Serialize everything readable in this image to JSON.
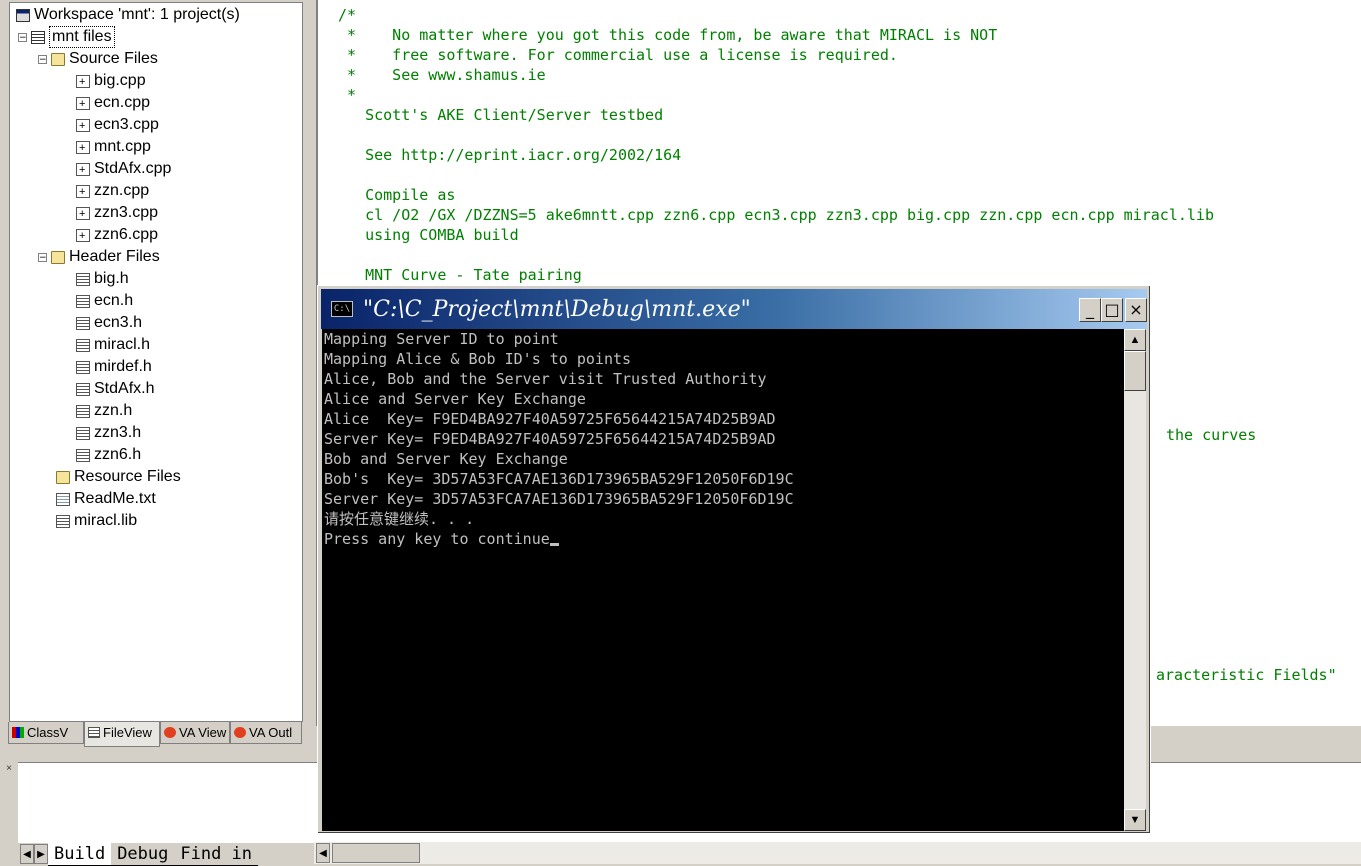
{
  "workspace": {
    "title": "Workspace 'mnt': 1 project(s)",
    "project": "mnt files",
    "source_folder": "Source Files",
    "source_files": [
      "big.cpp",
      "ecn.cpp",
      "ecn3.cpp",
      "mnt.cpp",
      "StdAfx.cpp",
      "zzn.cpp",
      "zzn3.cpp",
      "zzn6.cpp"
    ],
    "header_folder": "Header Files",
    "header_files": [
      "big.h",
      "ecn.h",
      "ecn3.h",
      "miracl.h",
      "mirdef.h",
      "StdAfx.h",
      "zzn.h",
      "zzn3.h",
      "zzn6.h"
    ],
    "resource_folder": "Resource Files",
    "other_files": [
      "ReadMe.txt",
      "miracl.lib"
    ],
    "tabs": [
      "ClassV",
      "FileView",
      "VA View",
      "VA Outl"
    ]
  },
  "editor": {
    "lines": [
      "/*",
      " *    No matter where you got this code from, be aware that MIRACL is NOT",
      " *    free software. For commercial use a license is required.",
      " *    See www.shamus.ie",
      " *",
      "   Scott's AKE Client/Server testbed",
      "",
      "   See http://eprint.iacr.org/2002/164",
      "",
      "   Compile as",
      "   cl /O2 /GX /DZZNS=5 ake6mntt.cpp zzn6.cpp ecn3.cpp zzn3.cpp big.cpp zzn.cpp ecn.cpp miracl.lib",
      "   using COMBA build",
      "",
      "   MNT Curve - Tate pairing"
    ],
    "fragment_1": "the curves",
    "fragment_2": "aracteristic Fields\""
  },
  "console": {
    "title": "\"C:\\C_Project\\mnt\\Debug\\mnt.exe\"",
    "icon_text": "C:\\",
    "buttons": {
      "minimize": "_",
      "maximize": "□",
      "close": "×"
    },
    "lines": [
      "Mapping Server ID to point",
      "Mapping Alice & Bob ID's to points",
      "Alice, Bob and the Server visit Trusted Authority",
      "Alice and Server Key Exchange",
      "Alice  Key= F9ED4BA927F40A59725F65644215A74D25B9AD",
      "Server Key= F9ED4BA927F40A59725F65644215A74D25B9AD",
      "Bob and Server Key Exchange",
      "Bob's  Key= 3D57A53FCA7AE136D173965BA529F12050F6D19C",
      "Server Key= 3D57A53FCA7AE136D173965BA529F12050F6D19C",
      "请按任意键继续. . ."
    ],
    "prompt": "Press any key to continue"
  },
  "output": {
    "tabs": [
      "Build",
      "Debug",
      "Find in"
    ]
  }
}
